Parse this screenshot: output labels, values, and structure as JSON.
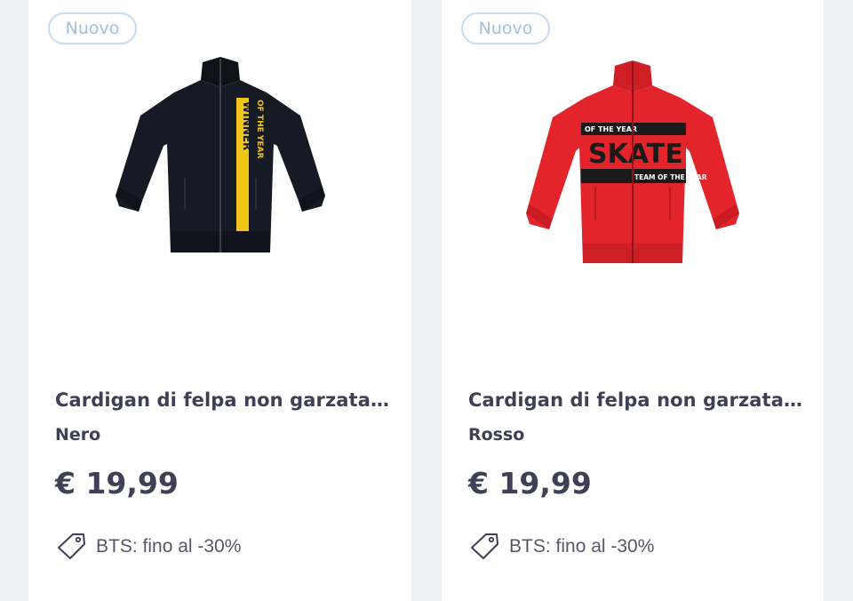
{
  "products": [
    {
      "badge": "Nuovo",
      "name": "Cardigan di felpa non garzata ...",
      "color": "Nero",
      "price": "€ 19,99",
      "promo": "BTS: fino al -30%",
      "jacket_color": "#161a24",
      "graphic_text": "WINNER OF THE YEAR",
      "graphic_color": "#f0c419"
    },
    {
      "badge": "Nuovo",
      "name": "Cardigan di felpa non garzata ...",
      "color": "Rosso",
      "price": "€ 19,99",
      "promo": "BTS: fino al -30%",
      "jacket_color": "#e3252b",
      "graphic_text": "TEAM OF THE YEAR",
      "graphic_color": "#1a1a1a"
    }
  ],
  "icons": {
    "promo": "tag-icon"
  }
}
